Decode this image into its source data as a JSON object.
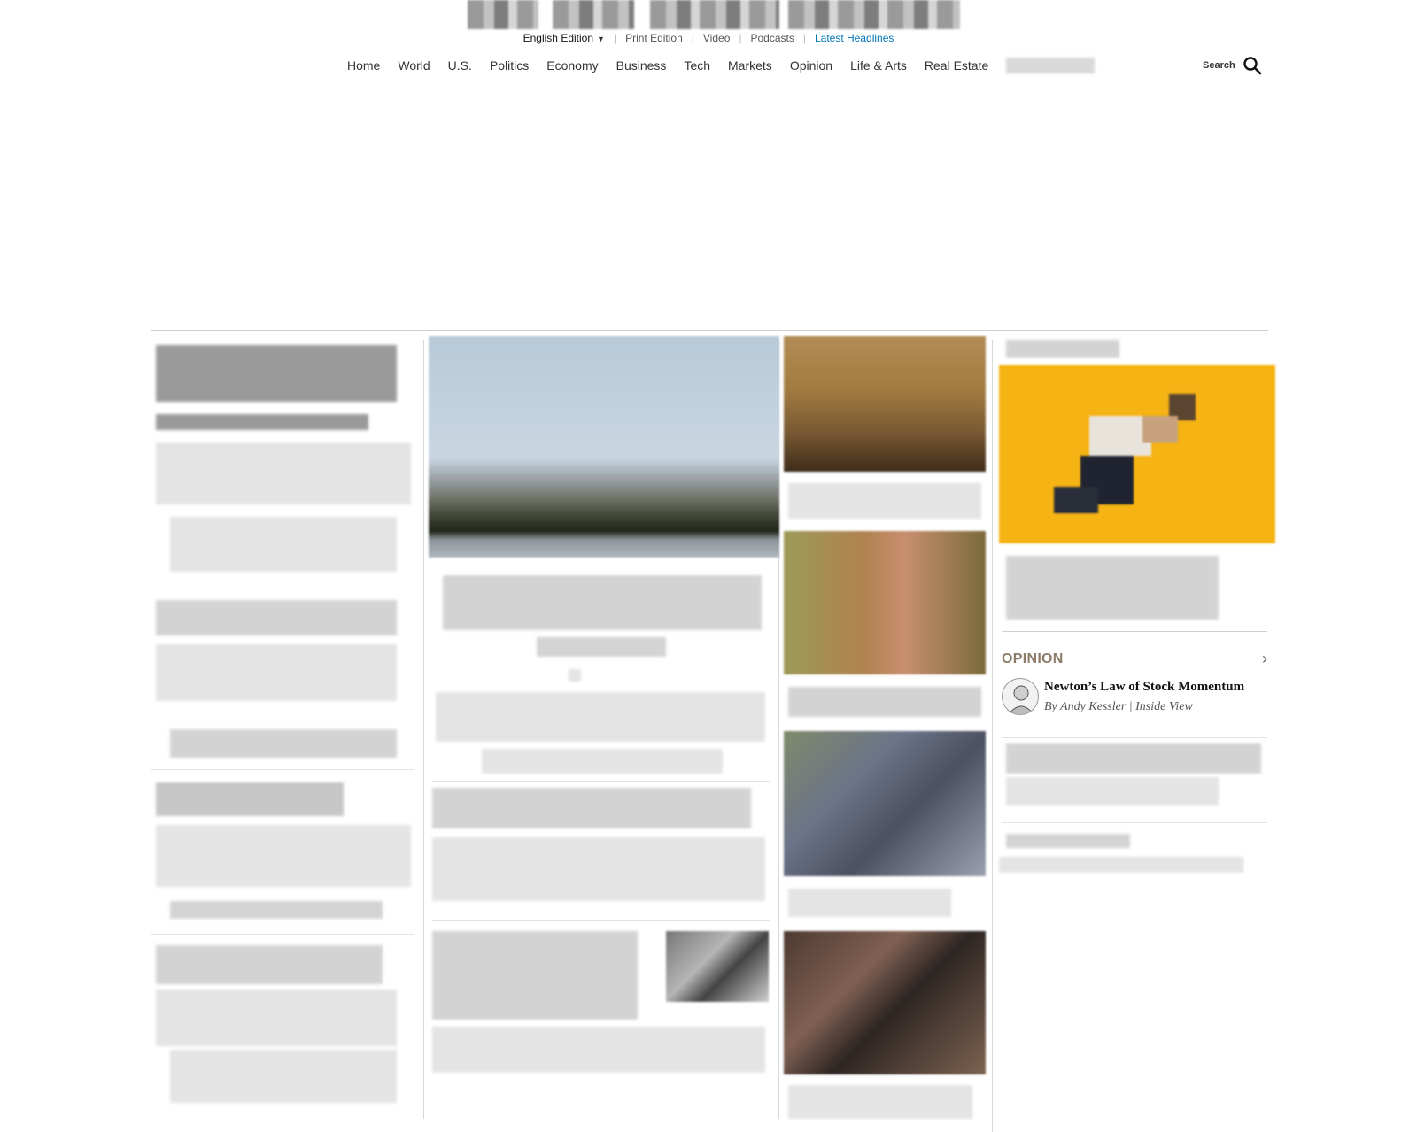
{
  "masthead": {
    "edition": "English Edition",
    "links": [
      "Print Edition",
      "Video",
      "Podcasts"
    ],
    "latest": "Latest Headlines"
  },
  "nav": {
    "items": [
      "Home",
      "World",
      "U.S.",
      "Politics",
      "Economy",
      "Business",
      "Tech",
      "Markets",
      "Opinion",
      "Life & Arts",
      "Real Estate"
    ]
  },
  "search": {
    "label": "Search"
  },
  "opinion": {
    "label": "OPINION",
    "headline": "Newton’s Law of Stock Momentum",
    "byline": "By Andy Kessler | Inside View"
  },
  "colors": {
    "accent": "#0274b6",
    "opinion_label": "#8c7b66",
    "promo_yellow": "#f6b314"
  },
  "icons": {
    "search": "search-icon",
    "edition_dropdown": "chevron-down-icon",
    "opinion_more": "chevron-right-icon"
  }
}
